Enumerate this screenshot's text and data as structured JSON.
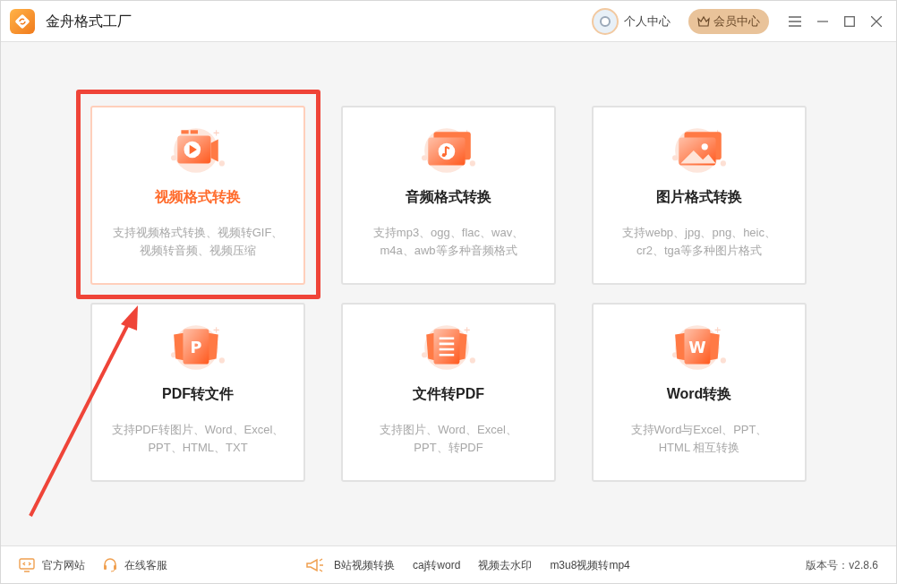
{
  "window": {
    "title": "金舟格式工厂"
  },
  "header": {
    "profile": "个人中心",
    "vip_button": "会员中心"
  },
  "cards": [
    {
      "kind": "video",
      "title": "视频格式转换",
      "selected": true,
      "description_lines": [
        "支持视频格式转换、视频转GIF、",
        "视频转音频、视频压缩"
      ]
    },
    {
      "kind": "audio",
      "title": "音频格式转换",
      "selected": false,
      "description_lines": [
        "支持mp3、ogg、flac、wav、",
        "m4a、awb等多种音频格式"
      ]
    },
    {
      "kind": "image",
      "title": "图片格式转换",
      "selected": false,
      "description_lines": [
        "支持webp、jpg、png、heic、",
        "cr2、tga等多种图片格式"
      ]
    },
    {
      "kind": "letter",
      "icon_letter": "P",
      "title": "PDF转文件",
      "selected": false,
      "description_lines": [
        "支持PDF转图片、Word、Excel、",
        "PPT、HTML、TXT"
      ]
    },
    {
      "kind": "document",
      "title": "文件转PDF",
      "selected": false,
      "description_lines": [
        "支持图片、Word、Excel、",
        "PPT、转PDF"
      ]
    },
    {
      "kind": "letter",
      "icon_letter": "W",
      "title": "Word转换",
      "selected": false,
      "description_lines": [
        "支持Word与Excel、PPT、",
        "HTML 相互转换"
      ]
    }
  ],
  "footer": {
    "left_links": [
      {
        "kind": "website",
        "label": "官方网站"
      },
      {
        "kind": "support",
        "label": "在线客服"
      }
    ],
    "quick_links": [
      "B站视频转换",
      "caj转word",
      "视频去水印",
      "m3u8视频转mp4"
    ],
    "version": "版本号：v2.8.6"
  }
}
